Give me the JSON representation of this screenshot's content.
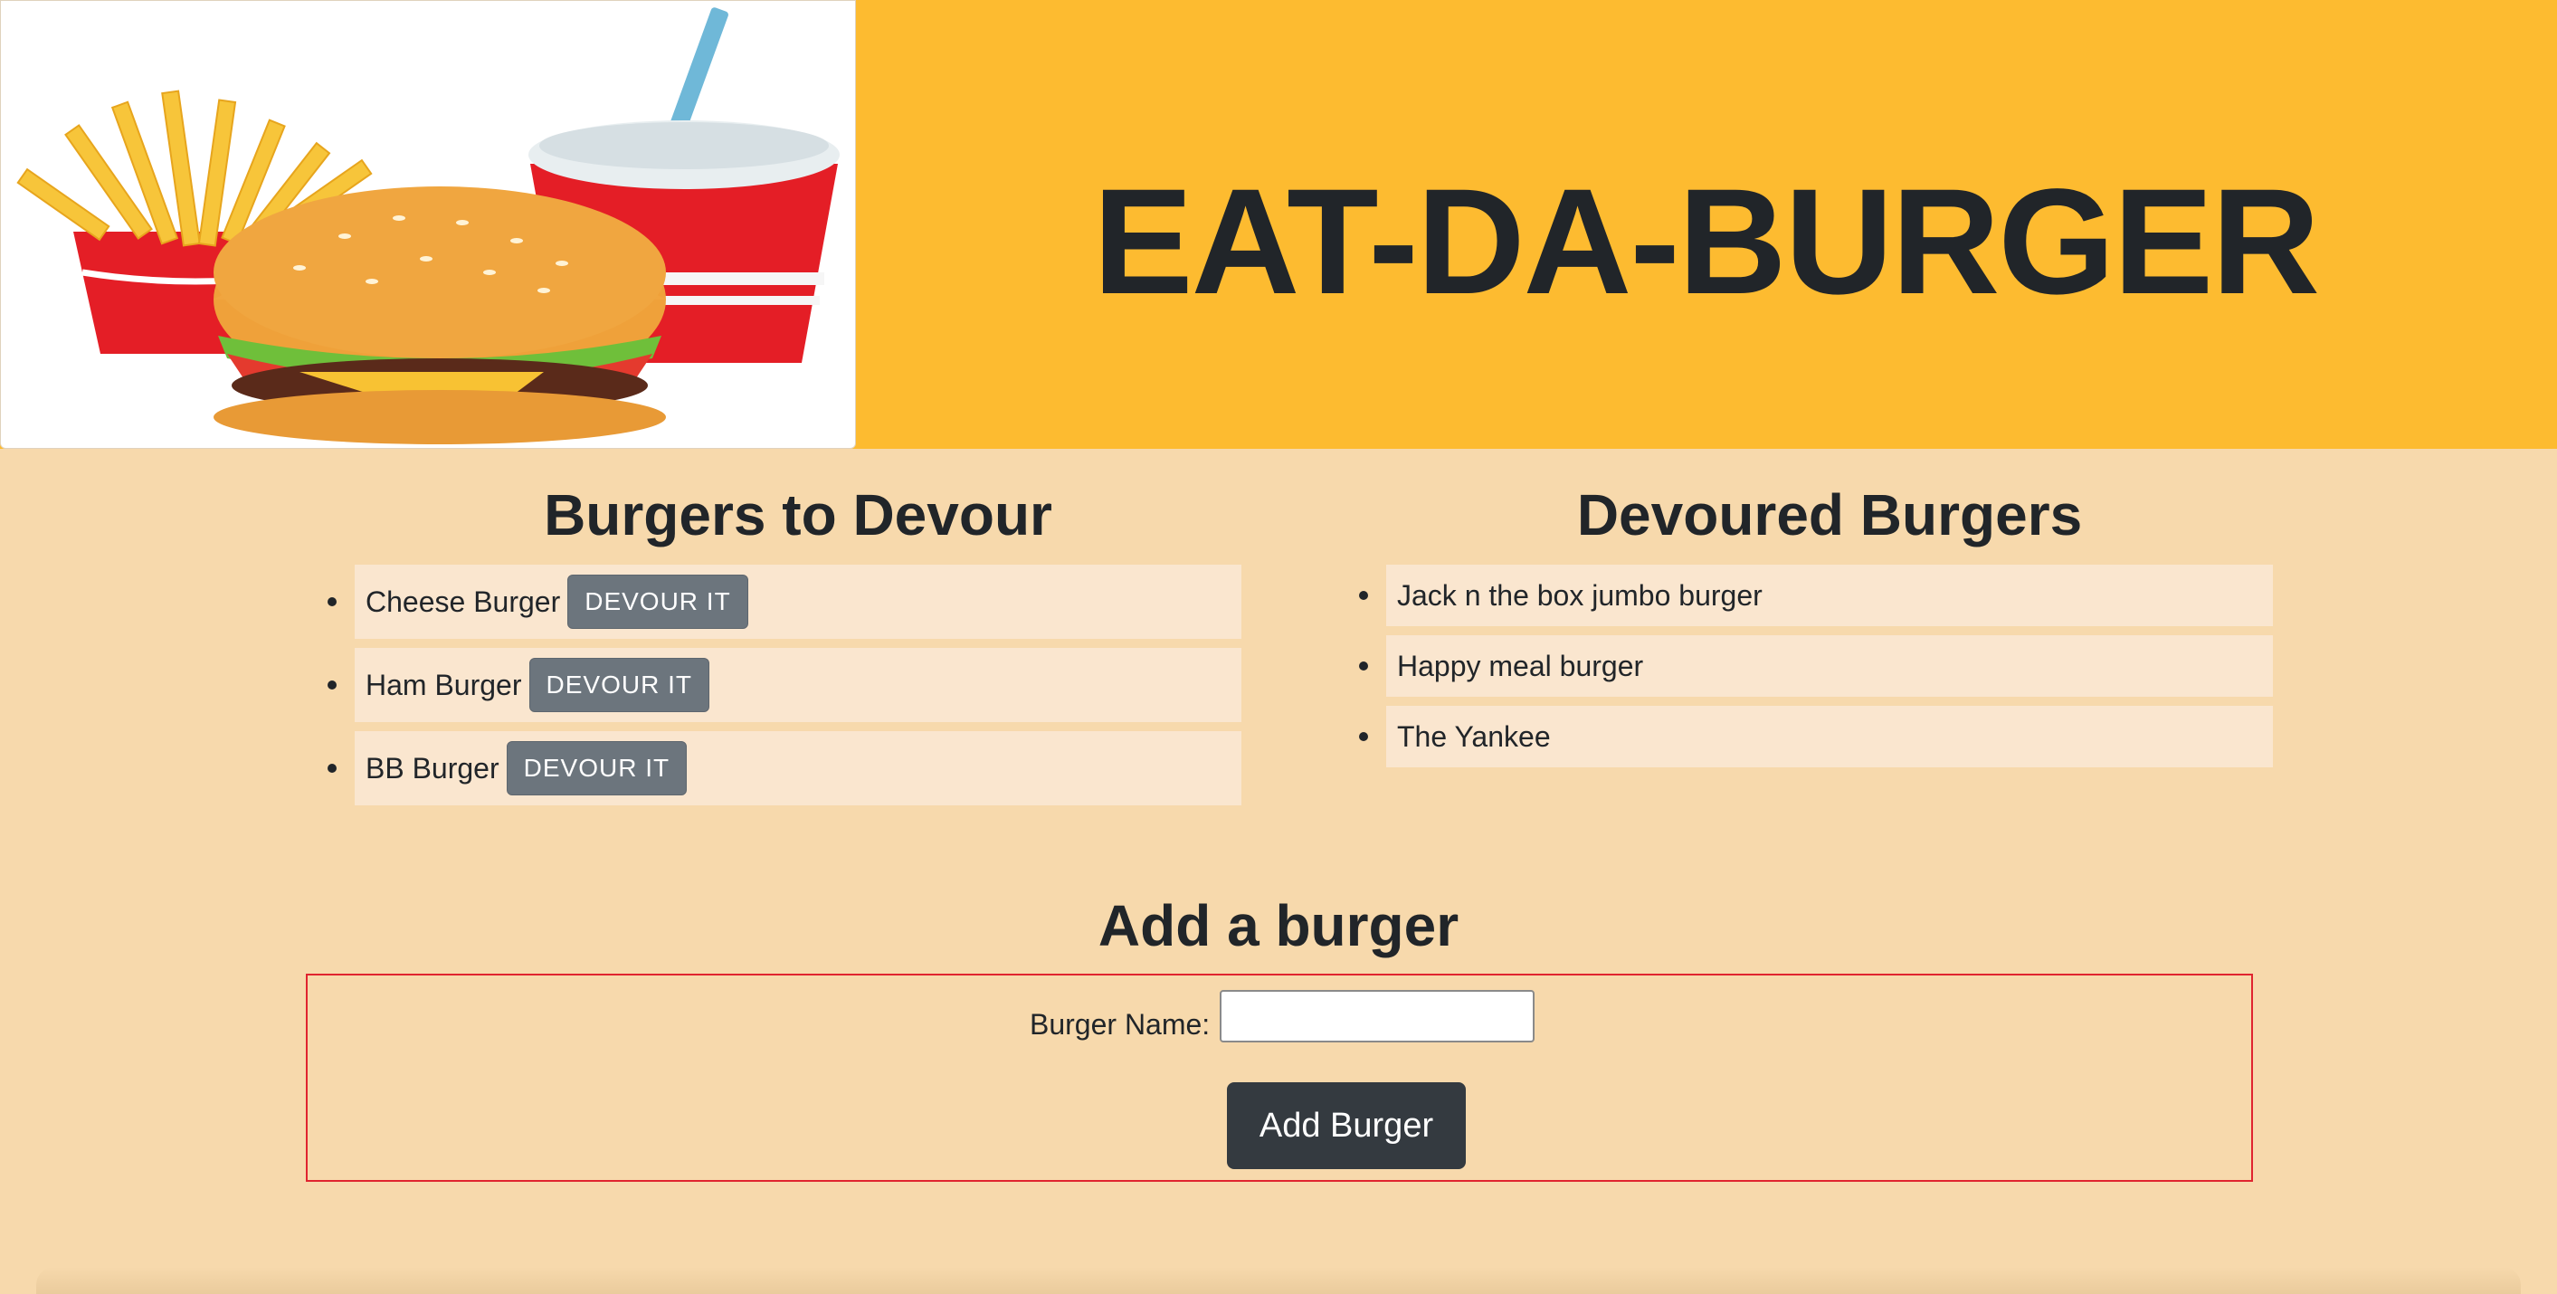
{
  "header": {
    "title": "EAT-DA-BURGER",
    "background_color": "#fdbb30",
    "logo_icon": "burger-fries-drink-icon"
  },
  "uneaten": {
    "heading": "Burgers to Devour",
    "items": [
      {
        "name": "Cheese Burger",
        "button": "DEVOUR IT"
      },
      {
        "name": "Ham Burger",
        "button": "DEVOUR IT"
      },
      {
        "name": "BB Burger",
        "button": "DEVOUR IT"
      }
    ]
  },
  "devoured": {
    "heading": "Devoured Burgers",
    "items": [
      {
        "name": "Jack n the box jumbo burger"
      },
      {
        "name": "Happy meal burger"
      },
      {
        "name": "The Yankee"
      }
    ]
  },
  "add_form": {
    "heading": "Add a burger",
    "label": "Burger Name:",
    "input_value": "",
    "submit_label": "Add Burger"
  },
  "colors": {
    "page_background": "#f7d9ac",
    "list_item_background": "#fae6cf",
    "devour_button": "#6c757d",
    "add_button": "#343a40",
    "form_border": "#e0242f"
  }
}
